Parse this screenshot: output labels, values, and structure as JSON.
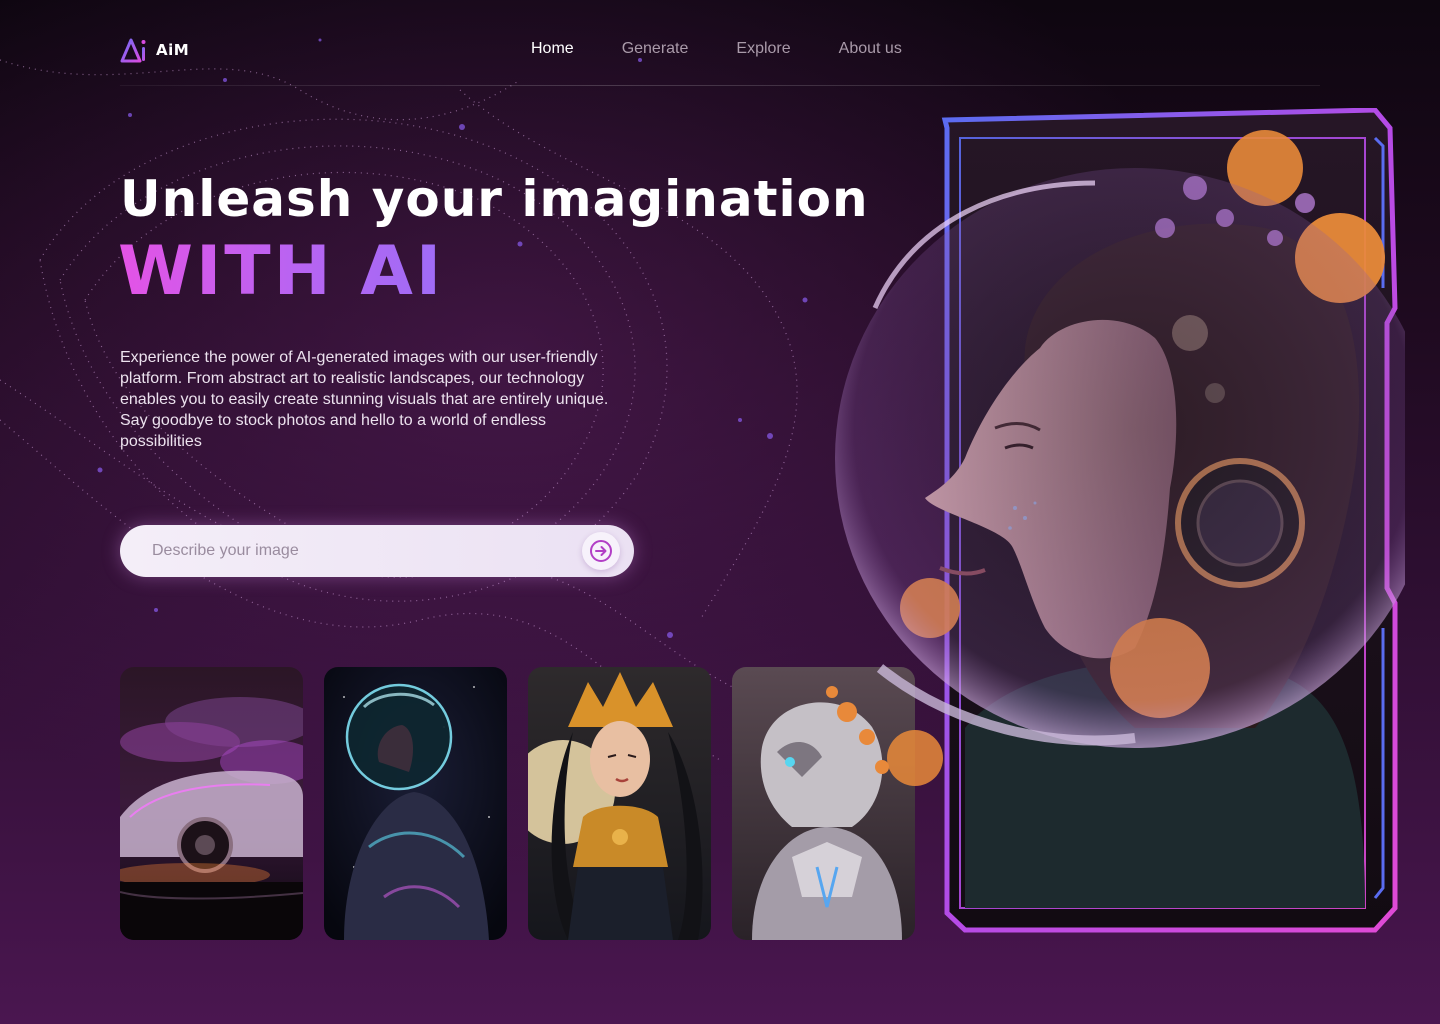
{
  "brand": {
    "name": "AiM",
    "mark": "Ai"
  },
  "nav": {
    "items": [
      {
        "label": "Home",
        "active": true
      },
      {
        "label": "Generate",
        "active": false
      },
      {
        "label": "Explore",
        "active": false
      },
      {
        "label": "About us",
        "active": false
      }
    ]
  },
  "hero": {
    "title": "Unleash your imagination",
    "accent": "WITH AI",
    "description": "Experience the power of AI-generated images with our user-friendly platform. From abstract art to realistic landscapes, our technology enables you to easily create stunning visuals that are entirely unique. Say goodbye to stock photos and hello to a world of endless possibilities"
  },
  "prompt": {
    "placeholder": "Describe your image",
    "value": "",
    "submit_icon": "arrow-right-circle-icon"
  },
  "gallery": {
    "items": [
      {
        "subject": "neon-sports-car"
      },
      {
        "subject": "astronaut-helmet"
      },
      {
        "subject": "golden-warrior-queen"
      },
      {
        "subject": "floral-robot"
      }
    ]
  },
  "featured": {
    "subject": "astronaut-woman-flowers"
  },
  "colors": {
    "accent_pink": "#e453e6",
    "accent_violet": "#9f6cf6",
    "frame_blue": "#5a6cf0",
    "frame_magenta": "#d84be0",
    "bg_dark": "#0e0610",
    "bg_purple": "#4a1650"
  }
}
